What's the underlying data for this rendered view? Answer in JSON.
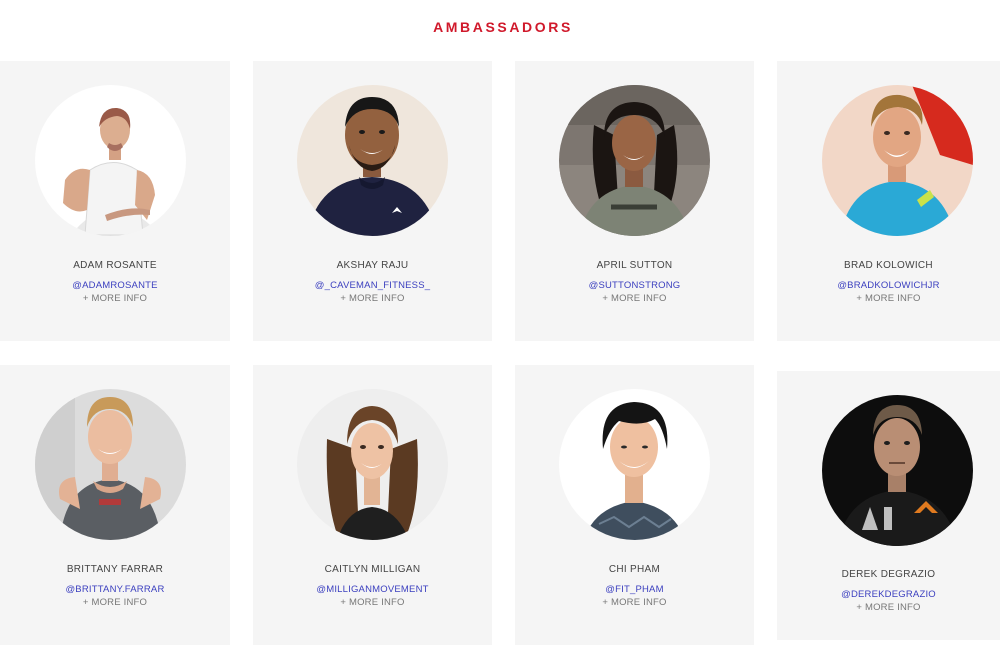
{
  "section": {
    "title": "AMBASSADORS"
  },
  "ambassadors": [
    {
      "name": "ADAM ROSANTE",
      "handle": "@ADAMROSANTE",
      "more": "+ MORE INFO"
    },
    {
      "name": "AKSHAY RAJU",
      "handle": "@_CAVEMAN_FITNESS_",
      "more": "+ MORE INFO"
    },
    {
      "name": "APRIL SUTTON",
      "handle": "@SUTTONSTRONG",
      "more": "+ MORE INFO"
    },
    {
      "name": "BRAD KOLOWICH",
      "handle": "@BRADKOLOWICHJR",
      "more": "+ MORE INFO"
    },
    {
      "name": "BRITTANY FARRAR",
      "handle": "@BRITTANY.FARRAR",
      "more": "+ MORE INFO"
    },
    {
      "name": "CAITLYN MILLIGAN",
      "handle": "@MILLIGANMOVEMENT",
      "more": "+ MORE INFO"
    },
    {
      "name": "CHI PHAM",
      "handle": "@FIT_PHAM",
      "more": "+ MORE INFO"
    },
    {
      "name": "DEREK DEGRAZIO",
      "handle": "@DEREKDEGRAZIO",
      "more": "+ MORE INFO"
    }
  ],
  "colors": {
    "accent": "#d0192b",
    "handle": "#3b3fbf",
    "card_bg": "#f5f5f5"
  }
}
